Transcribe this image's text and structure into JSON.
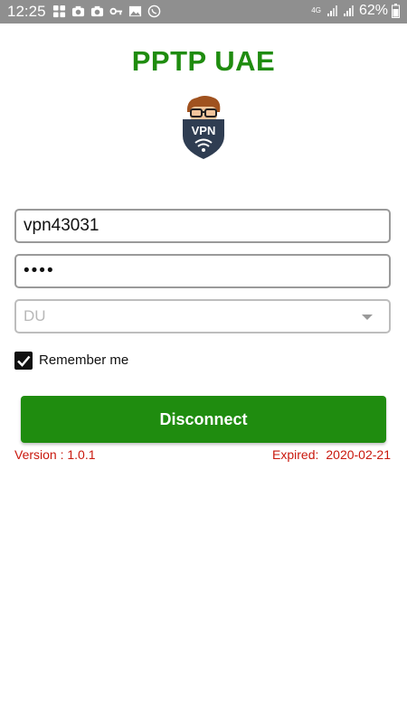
{
  "status_bar": {
    "time": "12:25",
    "network_label": "4G",
    "battery_percent": "62%"
  },
  "app": {
    "title": "PPTP UAE",
    "logo_text": "VPN"
  },
  "form": {
    "username": "vpn43031",
    "password_masked": "••••",
    "server_selected": "DU",
    "remember_label": "Remember me",
    "remember_checked": true
  },
  "action_button": {
    "label": "Disconnect"
  },
  "footer": {
    "version": "Version : 1.0.1",
    "expired_label": "Expired:",
    "expired_date": "2020-02-21"
  },
  "colors": {
    "primary_green": "#1f8c0f",
    "status_red": "#c9180d",
    "status_bar": "#8f8f8f"
  },
  "icons": [
    "grid-icon",
    "camera-icon",
    "camera-icon",
    "key-icon",
    "image-icon",
    "whatsapp-icon",
    "wifi-icon",
    "signal-icon",
    "signal-icon",
    "battery-icon"
  ]
}
